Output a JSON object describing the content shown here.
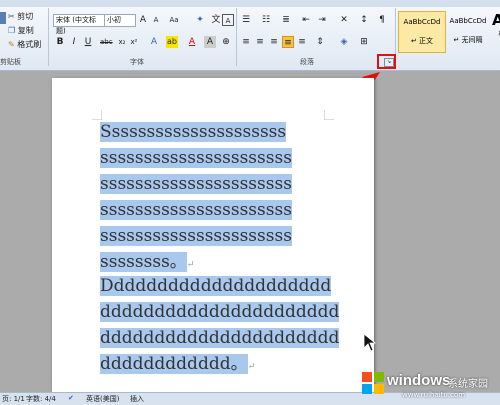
{
  "ribbon": {
    "clipboard": {
      "label": "剪贴板",
      "cut": "剪切",
      "copy": "复制",
      "format_painter": "格式刷"
    },
    "font": {
      "label": "字体",
      "face": "宋体 (中文标题)",
      "size": "小初"
    },
    "paragraph": {
      "label": "段落"
    },
    "styles": {
      "items": [
        {
          "preview": "AaBbCcDd",
          "name": "↵ 正文"
        },
        {
          "preview": "AaBbCcDd",
          "name": "↵ 无间隔"
        },
        {
          "preview": "Aa",
          "name": "标"
        }
      ]
    }
  },
  "document": {
    "lines": [
      "Sssssssssssssssssssss",
      "ssssssssssssssssssssss",
      "ssssssssssssssssssssss",
      "ssssssssssssssssssssss",
      "ssssssssssssssssssssss",
      "ssssssss。",
      "Ddddddddddddddddddddd",
      "dddddddddddddddddddddd",
      "dddddddddddddddddddddd",
      "dddddddddddd。"
    ],
    "paragraph_mark": "↵"
  },
  "status_bar": {
    "page": "页: 1/1",
    "words": "字数: 4/4",
    "language": "英语(美国)",
    "mode": "插入"
  },
  "watermark": {
    "brand": "windows",
    "site_text": "系统家园",
    "url": "www.ruihaitu.com"
  },
  "colors": {
    "selection": "#a8c8ee",
    "annotation": "#e01010",
    "ribbon": "#dfe8f3"
  }
}
